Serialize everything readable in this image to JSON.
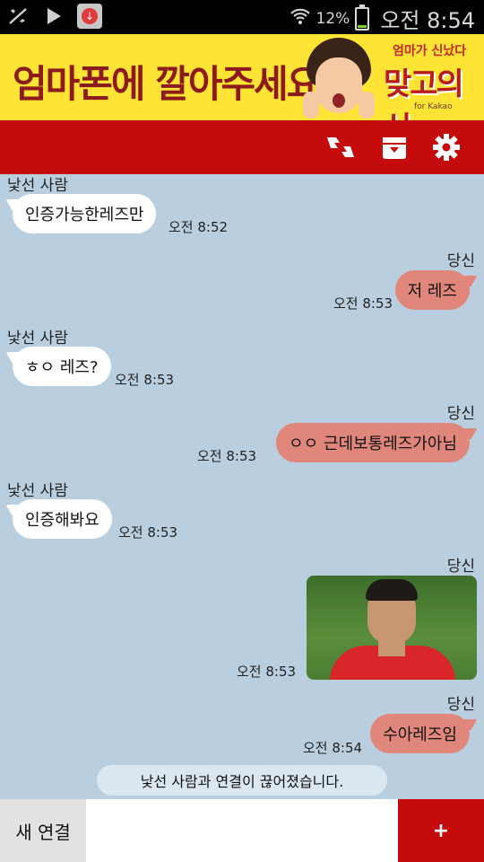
{
  "status_bar": {
    "icons": [
      "missed-call-icon",
      "play-store-icon",
      "download-icon"
    ],
    "battery_percent": "12%",
    "time": "오전 8:54"
  },
  "ad": {
    "text": "엄마폰에 깔아주세요",
    "logo_top": "엄마가 신났다",
    "logo": "맞고의신",
    "logo_sub": "for Kakao"
  },
  "toolbar": {
    "icons": [
      "thumbs-down-icon",
      "archive-icon",
      "gear-icon"
    ]
  },
  "chat": {
    "messages": [
      {
        "sender": "낯선 사람",
        "text": "인증가능한레즈만",
        "time": "오전 8:52",
        "side": "in"
      },
      {
        "sender": "당신",
        "text": "저 레즈",
        "time": "오전 8:53",
        "side": "out"
      },
      {
        "sender": "낯선 사람",
        "text": "ㅎㅇ 레즈?",
        "time": "오전 8:53",
        "side": "in"
      },
      {
        "sender": "당신",
        "text": "ㅇㅇ 근데보통레즈가아님",
        "time": "오전 8:53",
        "side": "out"
      },
      {
        "sender": "낯선 사람",
        "text": "인증해봐요",
        "time": "오전 8:53",
        "side": "in"
      },
      {
        "sender": "당신",
        "text": "",
        "time": "오전 8:53",
        "side": "out",
        "type": "photo"
      },
      {
        "sender": "당신",
        "text": "수아레즈임",
        "time": "오전 8:54",
        "side": "out"
      }
    ],
    "notice": "낯선 사람과 연결이 끊어졌습니다."
  },
  "bottom_bar": {
    "new_connection_label": "새 연결",
    "input_value": "",
    "send_label": "+"
  },
  "colors": {
    "chat_background": "#b9cfe0",
    "toolbar": "#c40a0a",
    "outgoing_bubble": "#e0867a",
    "incoming_bubble": "#ffffff",
    "ad_background": "#ffe436"
  }
}
